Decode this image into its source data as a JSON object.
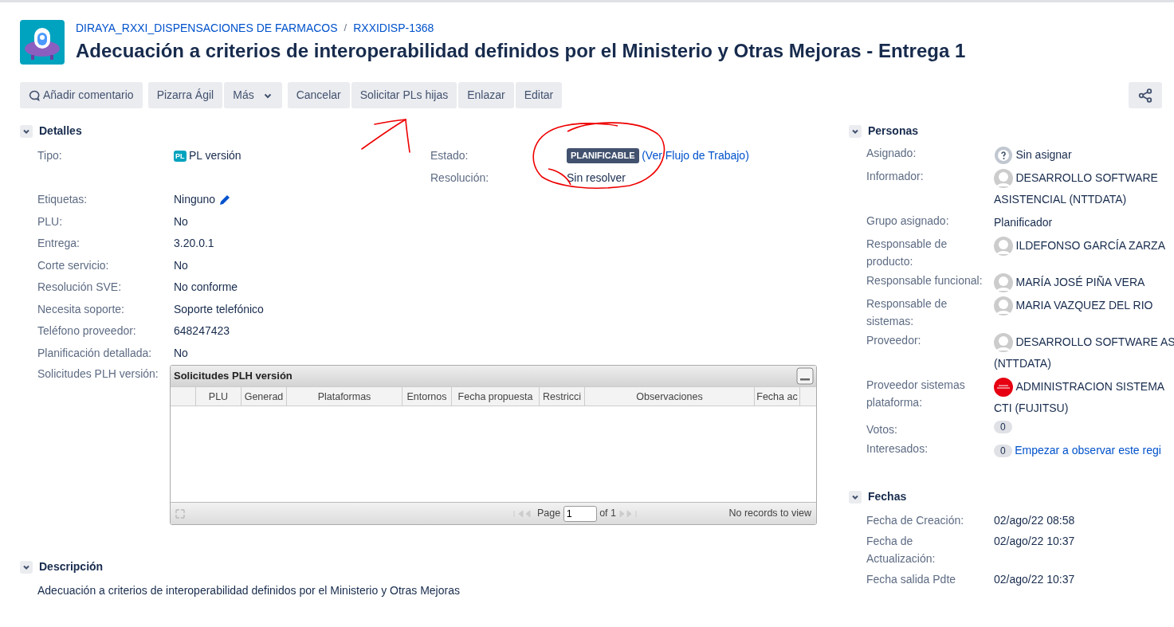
{
  "breadcrumb": {
    "project": "DIRAYA_RXXI_DISPENSACIONES DE FARMACOS",
    "separator": "/",
    "issue_key": "RXXIDISP-1368"
  },
  "title": "Adecuación a criterios de interoperabilidad definidos por el Ministerio y Otras Mejoras - Entrega 1",
  "toolbar": [
    [
      {
        "label": "Añadir comentario",
        "kind": "comment"
      }
    ],
    [
      {
        "label": "Pizarra Ágil",
        "kind": "plain"
      },
      {
        "label": "Más",
        "kind": "dropdown"
      }
    ],
    [
      {
        "label": "Cancelar",
        "kind": "plain"
      },
      {
        "label": "Solicitar PLs hijas",
        "kind": "plain"
      },
      {
        "label": "Enlazar",
        "kind": "plain"
      },
      {
        "label": "Editar",
        "kind": "plain"
      }
    ]
  ],
  "details": {
    "heading": "Detalles",
    "expanded": true,
    "type_field": {
      "label": "Tipo:",
      "icon_text": "PL",
      "value": "PL versión"
    },
    "status_fields": [
      {
        "label": "Estado:",
        "kind": "status",
        "value": "PLANIFICABLE",
        "link": "(Ver Flujo de Trabajo)"
      },
      {
        "label": "Resolución:",
        "kind": "text",
        "value": "Sin resolver"
      }
    ],
    "fields": [
      {
        "label": "Etiquetas:",
        "kind": "editable",
        "value": "Ninguno"
      },
      {
        "label": "PLU:",
        "kind": "text",
        "value": "No"
      },
      {
        "label": "Entrega:",
        "kind": "text",
        "value": "3.20.0.1"
      },
      {
        "label": "Corte servicio:",
        "kind": "text",
        "value": "No"
      },
      {
        "label": "Resolución SVE:",
        "kind": "text",
        "value": "No conforme"
      },
      {
        "label": "Necesita soporte:",
        "kind": "text",
        "value": "Soporte telefónico"
      },
      {
        "label": "Teléfono proveedor:",
        "kind": "text",
        "value": "648247423"
      },
      {
        "label": "Planificación detallada:",
        "kind": "text",
        "value": "No"
      }
    ],
    "grid_field": {
      "label": "Solicitudes PLH versión:",
      "grid": {
        "title": "Solicitudes PLH versión",
        "columns": [
          "",
          "PLU",
          "Generad",
          "Plataformas",
          "Entornos",
          "Fecha propuesta",
          "Restricci",
          "Observaciones",
          "Fecha ac"
        ],
        "pager": {
          "page_label": "Page",
          "page": "1",
          "of": "of 1",
          "records": "No records to view"
        }
      }
    }
  },
  "description": {
    "heading": "Descripción",
    "expanded": true,
    "text": "Adecuación a criterios de interoperabilidad definidos por el Ministerio y Otras Mejoras"
  },
  "people": {
    "heading": "Personas",
    "expanded": true,
    "rows": [
      {
        "label": "Asignado:",
        "kind": "unassigned",
        "lines": [
          "Sin asignar"
        ]
      },
      {
        "label": "Informador:",
        "kind": "user",
        "lines": [
          "DESARROLLO SOFTWARE",
          "ASISTENCIAL (NTTDATA)"
        ]
      },
      {
        "label": "Grupo asignado:",
        "kind": "text",
        "lines": [
          "Planificador"
        ]
      },
      {
        "label": "Responsable de producto:",
        "kind": "user",
        "lines": [
          "ILDEFONSO GARCÍA ZARZA"
        ]
      },
      {
        "label": "Responsable funcional:",
        "kind": "user",
        "lines": [
          "MARÍA JOSÉ PIÑA VERA"
        ]
      },
      {
        "label": "Responsable de sistemas:",
        "kind": "user",
        "lines": [
          "MARIA VAZQUEZ DEL RIO"
        ]
      },
      {
        "label": "Proveedor:",
        "kind": "user",
        "lines": [
          "DESARROLLO SOFTWARE AS",
          "(NTTDATA)"
        ]
      },
      {
        "label": "Proveedor sistemas plataforma:",
        "kind": "company",
        "lines": [
          "ADMINISTRACION SISTEMA",
          "CTI (FUJITSU)"
        ]
      },
      {
        "label": "Votos:",
        "kind": "count",
        "count": "0"
      },
      {
        "label": "Interesados:",
        "kind": "count",
        "count": "0",
        "link": "Empezar a observar este regi"
      }
    ]
  },
  "dates": {
    "heading": "Fechas",
    "expanded": true,
    "rows": [
      {
        "label": "Fecha de Creación:",
        "value": "02/ago/22 08:58"
      },
      {
        "label": "Fecha de Actualización:",
        "value": "02/ago/22 10:37"
      },
      {
        "label": "Fecha salida Pdte",
        "value": "02/ago/22 10:37"
      }
    ]
  }
}
